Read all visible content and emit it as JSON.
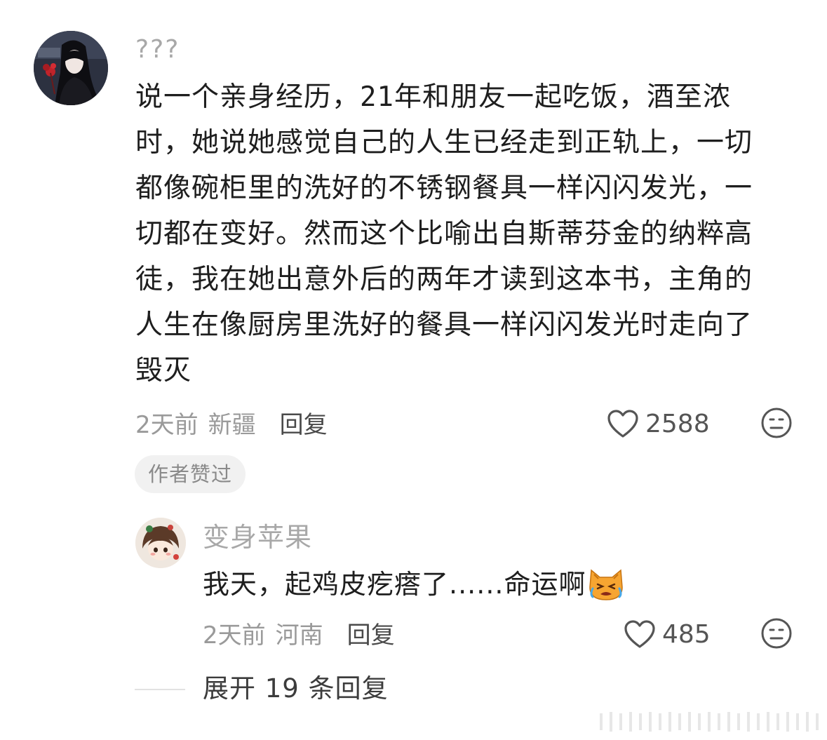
{
  "main_comment": {
    "username": "???",
    "text": "说一个亲身经历，21年和朋友一起吃饭，酒至浓\n时，她说她感觉自己的人生已经走到正轨上，一切\n都像碗柜里的洗好的不锈钢餐具一样闪闪发光，一\n切都在变好。然而这个比喻出自斯蒂芬金的纳粹高\n徒，我在她出意外后的两年才读到这本书，主角的\n人生在像厨房里洗好的餐具一样闪闪发光时走向了\n毁灭",
    "time": "2天前",
    "location": "新疆",
    "reply_label": "回复",
    "like_count": "2588",
    "author_badge": "作者赞过"
  },
  "reply_comment": {
    "username": "变身苹果",
    "text": "我天，起鸡皮疙瘩了......命运啊",
    "emoji": "crying-cat-emoji",
    "time": "2天前",
    "location": "河南",
    "reply_label": "回复",
    "like_count": "485"
  },
  "expand": {
    "label": "展开 19 条回复"
  },
  "icons": {
    "like": "heart-outline-icon",
    "dislike": "meh-face-icon"
  },
  "colors": {
    "username": "#a8a8a8",
    "body_text": "#1e1e1e",
    "meta_text": "#9a9a9a",
    "badge_bg": "#f1f1f1"
  }
}
